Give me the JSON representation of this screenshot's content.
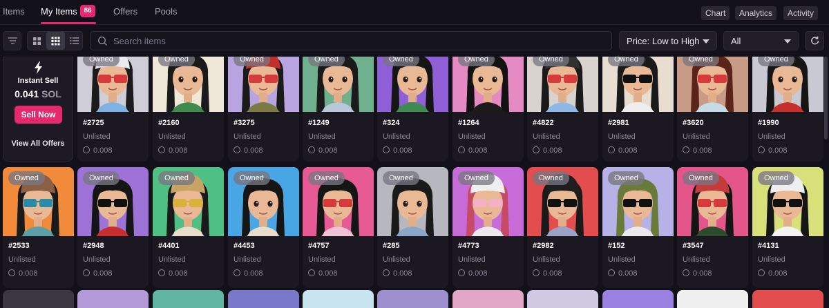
{
  "tabs": [
    {
      "label": "Items",
      "active": false
    },
    {
      "label": "My Items",
      "active": true,
      "badge": "86"
    },
    {
      "label": "Offers",
      "active": false
    },
    {
      "label": "Pools",
      "active": false
    }
  ],
  "header_buttons": [
    "Chart",
    "Analytics",
    "Activity"
  ],
  "toolbar": {
    "search_placeholder": "Search items",
    "sort_value": "Price: Low to High",
    "filter_value": "All"
  },
  "instant_sell": {
    "title": "Instant Sell",
    "price": "0.041",
    "unit": "SOL",
    "button": "Sell Now",
    "link": "View All Offers"
  },
  "owned_label": "Owned",
  "items_row1": [
    {
      "name": "#2725",
      "status": "Unlisted",
      "price": "0.008",
      "bg": "#cfcdd6",
      "hair": "#1b1b1b",
      "hat": "#e9e9ee",
      "glasses": "#d63a3a",
      "shirt": "#7db3e3"
    },
    {
      "name": "#2160",
      "status": "Unlisted",
      "price": "0.008",
      "bg": "#efe8d8",
      "hair": "#1a1a1a",
      "hat": "none",
      "glasses": "none",
      "shirt": "#3f8a4e"
    },
    {
      "name": "#3275",
      "status": "Unlisted",
      "price": "0.008",
      "bg": "#b8a4e0",
      "hair": "#1a1a1a",
      "hat": "#c2302e",
      "glasses": "#d63a3a",
      "shirt": "#7b7a45"
    },
    {
      "name": "#1249",
      "status": "Unlisted",
      "price": "0.008",
      "bg": "#6fb08f",
      "hair": "#1a1a1a",
      "hat": "none",
      "glasses": "none",
      "shirt": "#b9c7d8"
    },
    {
      "name": "#324",
      "status": "Unlisted",
      "price": "0.008",
      "bg": "#8e5fd6",
      "hair": "#151515",
      "hat": "none",
      "glasses": "none",
      "shirt": "#3f8a4e"
    },
    {
      "name": "#1264",
      "status": "Unlisted",
      "price": "0.008",
      "bg": "#e58ac2",
      "hair": "#121212",
      "hat": "none",
      "glasses": "none",
      "shirt": "#1b1b1b"
    },
    {
      "name": "#4822",
      "status": "Unlisted",
      "price": "0.008",
      "bg": "#d9d3cf",
      "hair": "#1a1a1a",
      "hat": "#303030",
      "glasses": "#d63a3a",
      "shirt": "#8db8e6"
    },
    {
      "name": "#2981",
      "status": "Unlisted",
      "price": "0.008",
      "bg": "#e7ddd0",
      "hair": "#1a1a1a",
      "hat": "none",
      "glasses": "#111111",
      "shirt": "#eeeeee"
    },
    {
      "name": "#3620",
      "status": "Unlisted",
      "price": "0.008",
      "bg": "#c99a86",
      "hair": "#5a2418",
      "hat": "none",
      "glasses": "#d63a3a",
      "shirt": "#c7dbe6"
    },
    {
      "name": "#1990",
      "status": "Unlisted",
      "price": "0.008",
      "bg": "#c8c9d3",
      "hair": "#151515",
      "hat": "none",
      "glasses": "none",
      "shirt": "#c5302e"
    }
  ],
  "items_row2": [
    {
      "name": "#2533",
      "status": "Unlisted",
      "price": "0.008",
      "bg": "#f28a3c",
      "hair": "#1a1a1a",
      "hat": "#8a5f44",
      "glasses": "#2a8aa8",
      "shirt": "#5aa0a6"
    },
    {
      "name": "#2948",
      "status": "Unlisted",
      "price": "0.008",
      "bg": "#9d73d8",
      "hair": "#151515",
      "hat": "none",
      "glasses": "#111111",
      "shirt": "#c5302e"
    },
    {
      "name": "#4401",
      "status": "Unlisted",
      "price": "0.008",
      "bg": "#4fbf83",
      "hair": "#1a1a1a",
      "hat": "#c9a266",
      "glasses": "#d8b23a",
      "shirt": "#e9dccb"
    },
    {
      "name": "#4453",
      "status": "Unlisted",
      "price": "0.008",
      "bg": "#49a6e4",
      "hair": "#151515",
      "hat": "none",
      "glasses": "none",
      "shirt": "#e9dccb"
    },
    {
      "name": "#4757",
      "status": "Unlisted",
      "price": "0.008",
      "bg": "#e85a93",
      "hair": "#151515",
      "hat": "none",
      "glasses": "#d63a3a",
      "shirt": "#f0c2d6"
    },
    {
      "name": "#285",
      "status": "Unlisted",
      "price": "0.008",
      "bg": "#b7b7bf",
      "hair": "#1a1a1a",
      "hat": "none",
      "glasses": "none",
      "shirt": "#8aa6c9"
    },
    {
      "name": "#4773",
      "status": "Unlisted",
      "price": "0.008",
      "bg": "#c76bd8",
      "hair": "#c54a64",
      "hat": "#efeff2",
      "glasses": "#f3b1c6",
      "shirt": "#e9e9ee"
    },
    {
      "name": "#2982",
      "status": "Unlisted",
      "price": "0.008",
      "bg": "#e44d4d",
      "hair": "#1a1a1a",
      "hat": "#1e1e1e",
      "glasses": "#111111",
      "shirt": "#9aa2c7"
    },
    {
      "name": "#152",
      "status": "Unlisted",
      "price": "0.008",
      "bg": "#b6b1e6",
      "hair": "#6a7a3a",
      "hat": "none",
      "glasses": "#111111",
      "shirt": "#e9e9ee"
    },
    {
      "name": "#3547",
      "status": "Unlisted",
      "price": "0.008",
      "bg": "#e4568a",
      "hair": "#151515",
      "hat": "#c53a3a",
      "glasses": "#d63a3a",
      "shirt": "#2c4a2e"
    },
    {
      "name": "#4131",
      "status": "Unlisted",
      "price": "0.008",
      "bg": "#d8e07a",
      "hair": "#151515",
      "hat": "#efeff2",
      "glasses": "#111111",
      "shirt": "#f2f2f2"
    }
  ]
}
